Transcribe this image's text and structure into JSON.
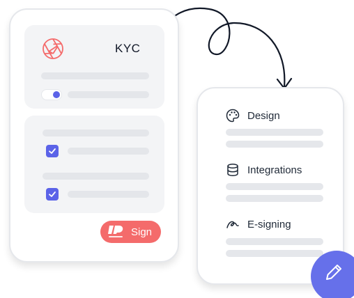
{
  "colors": {
    "accent": "#5b63e8",
    "sign_button": "#f46b6b",
    "fab": "#6670ea",
    "panel": "#f3f4f6",
    "placeholder_bar": "#e5e7eb"
  },
  "kyc_card": {
    "title": "KYC",
    "icon": "aperture-icon",
    "toggle_on": true,
    "checkboxes_checked": [
      true,
      true
    ],
    "sign_button": {
      "label": "Sign",
      "logo": "brand-logo-icon"
    }
  },
  "features_card": {
    "items": [
      {
        "label": "Design",
        "icon": "palette-icon"
      },
      {
        "label": "Integrations",
        "icon": "database-icon"
      },
      {
        "label": "E-signing",
        "icon": "signature-icon"
      }
    ]
  },
  "fab": {
    "icon": "pencil-icon"
  }
}
